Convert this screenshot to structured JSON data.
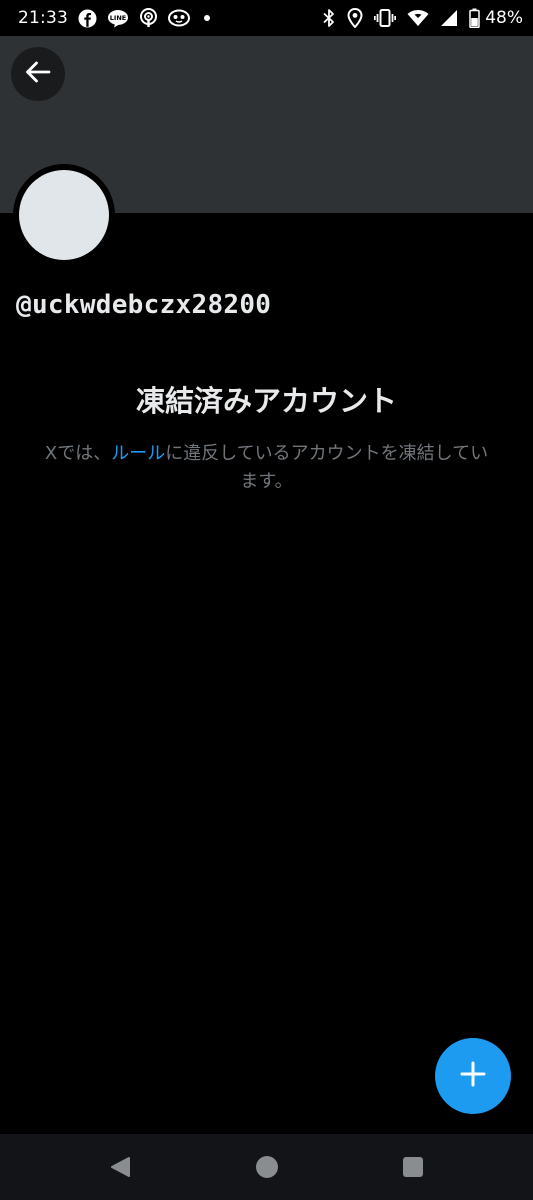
{
  "status_bar": {
    "time": "21:33",
    "left_icons": [
      "facebook-icon",
      "line-icon",
      "podcast-icon",
      "game-icon",
      "dot-icon"
    ],
    "right_icons": [
      "bluetooth-icon",
      "location-icon",
      "vibrate-icon",
      "wifi-icon",
      "signal-icon",
      "battery-icon"
    ],
    "battery": "48%"
  },
  "header": {
    "back_icon": "arrow-left-icon",
    "banner_color": "#2e3235"
  },
  "profile": {
    "avatar_color": "#e1e6ea",
    "username": "@uckwdebczx28200"
  },
  "suspended": {
    "title": "凍結済みアカウント",
    "desc_before": "Xでは、",
    "rules_link": "ルール",
    "desc_after": "に違反しているアカウントを凍結しています。"
  },
  "fab": {
    "icon": "plus-icon",
    "color": "#1d9bf0"
  },
  "nav_bar": {
    "buttons": [
      "nav-back-icon",
      "nav-home-icon",
      "nav-recents-icon"
    ]
  }
}
